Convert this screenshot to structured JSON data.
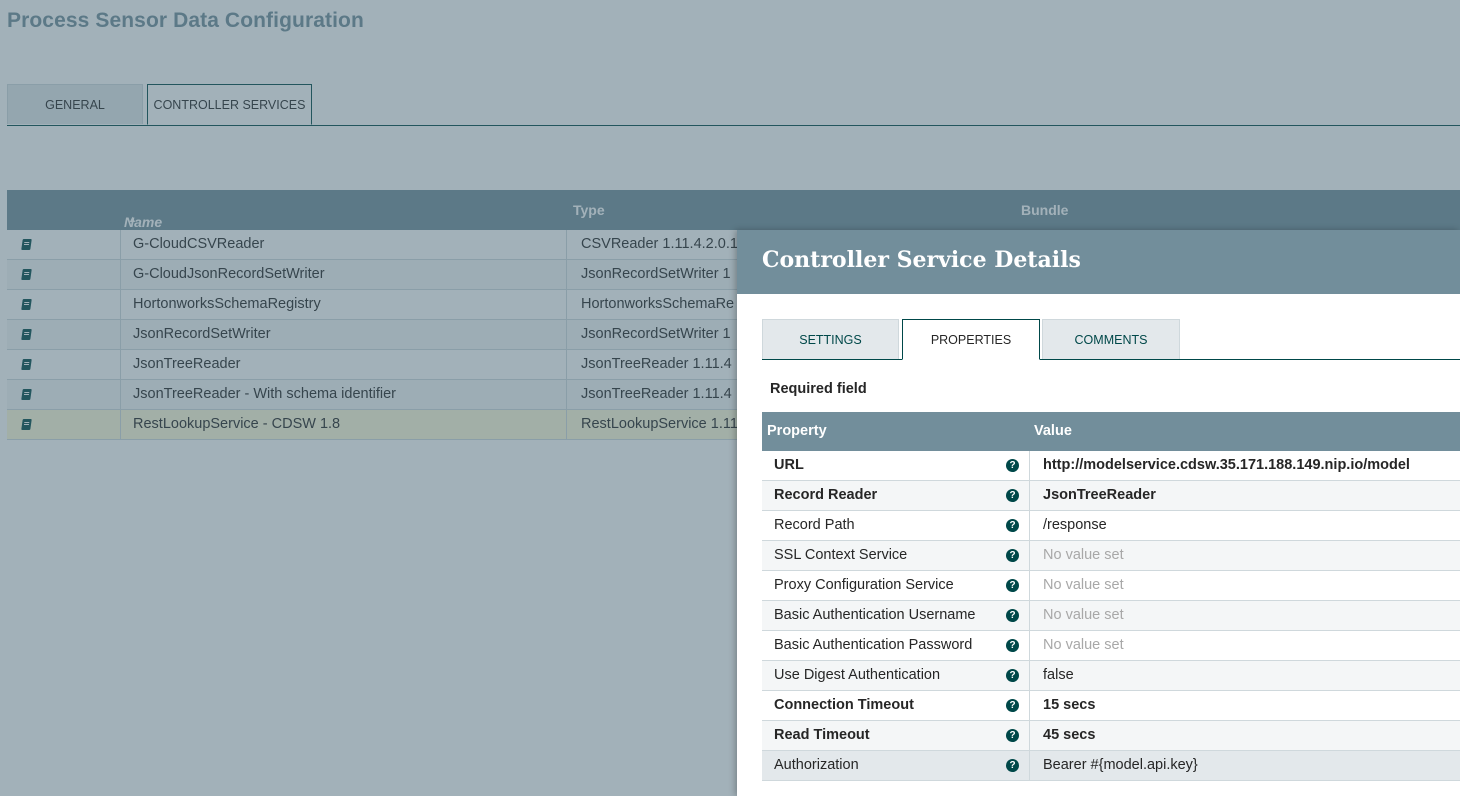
{
  "page": {
    "title": "Process Sensor Data Configuration",
    "tabs": [
      "GENERAL",
      "CONTROLLER SERVICES"
    ]
  },
  "services_table": {
    "columns": {
      "name": "Name",
      "type": "Type",
      "bundle": "Bundle"
    },
    "sort_indicator": "▲",
    "rows": [
      {
        "name": "G-CloudCSVReader",
        "type": "CSVReader 1.11.4.2.0.1"
      },
      {
        "name": "G-CloudJsonRecordSetWriter",
        "type": "JsonRecordSetWriter 1"
      },
      {
        "name": "HortonworksSchemaRegistry",
        "type": "HortonworksSchemaRe"
      },
      {
        "name": "JsonRecordSetWriter",
        "type": "JsonRecordSetWriter 1"
      },
      {
        "name": "JsonTreeReader",
        "type": "JsonTreeReader 1.11.4"
      },
      {
        "name": "JsonTreeReader - With schema identifier",
        "type": "JsonTreeReader 1.11.4"
      },
      {
        "name": "RestLookupService - CDSW 1.8",
        "type": "RestLookupService 1.11"
      }
    ]
  },
  "dialog": {
    "title": "Controller Service Details",
    "tabs": {
      "settings": "SETTINGS",
      "properties": "PROPERTIES",
      "comments": "COMMENTS"
    },
    "required_field_label": "Required field",
    "table_headers": {
      "property": "Property",
      "value": "Value"
    },
    "help_glyph": "?",
    "properties": [
      {
        "name": "URL",
        "value": "http://modelservice.cdsw.35.171.188.149.nip.io/model",
        "required": true
      },
      {
        "name": "Record Reader",
        "value": "JsonTreeReader",
        "required": true
      },
      {
        "name": "Record Path",
        "value": "/response",
        "required": false
      },
      {
        "name": "SSL Context Service",
        "value": "No value set",
        "required": false
      },
      {
        "name": "Proxy Configuration Service",
        "value": "No value set",
        "required": false
      },
      {
        "name": "Basic Authentication Username",
        "value": "No value set",
        "required": false
      },
      {
        "name": "Basic Authentication Password",
        "value": "No value set",
        "required": false
      },
      {
        "name": "Use Digest Authentication",
        "value": "false",
        "required": false
      },
      {
        "name": "Connection Timeout",
        "value": "15 secs",
        "required": true
      },
      {
        "name": "Read Timeout",
        "value": "45 secs",
        "required": true
      },
      {
        "name": "Authorization",
        "value": "Bearer #{model.api.key}",
        "required": false
      }
    ]
  },
  "colors": {
    "header_bg": "#728e9b",
    "accent": "#004849",
    "overlay": "#45647380"
  }
}
